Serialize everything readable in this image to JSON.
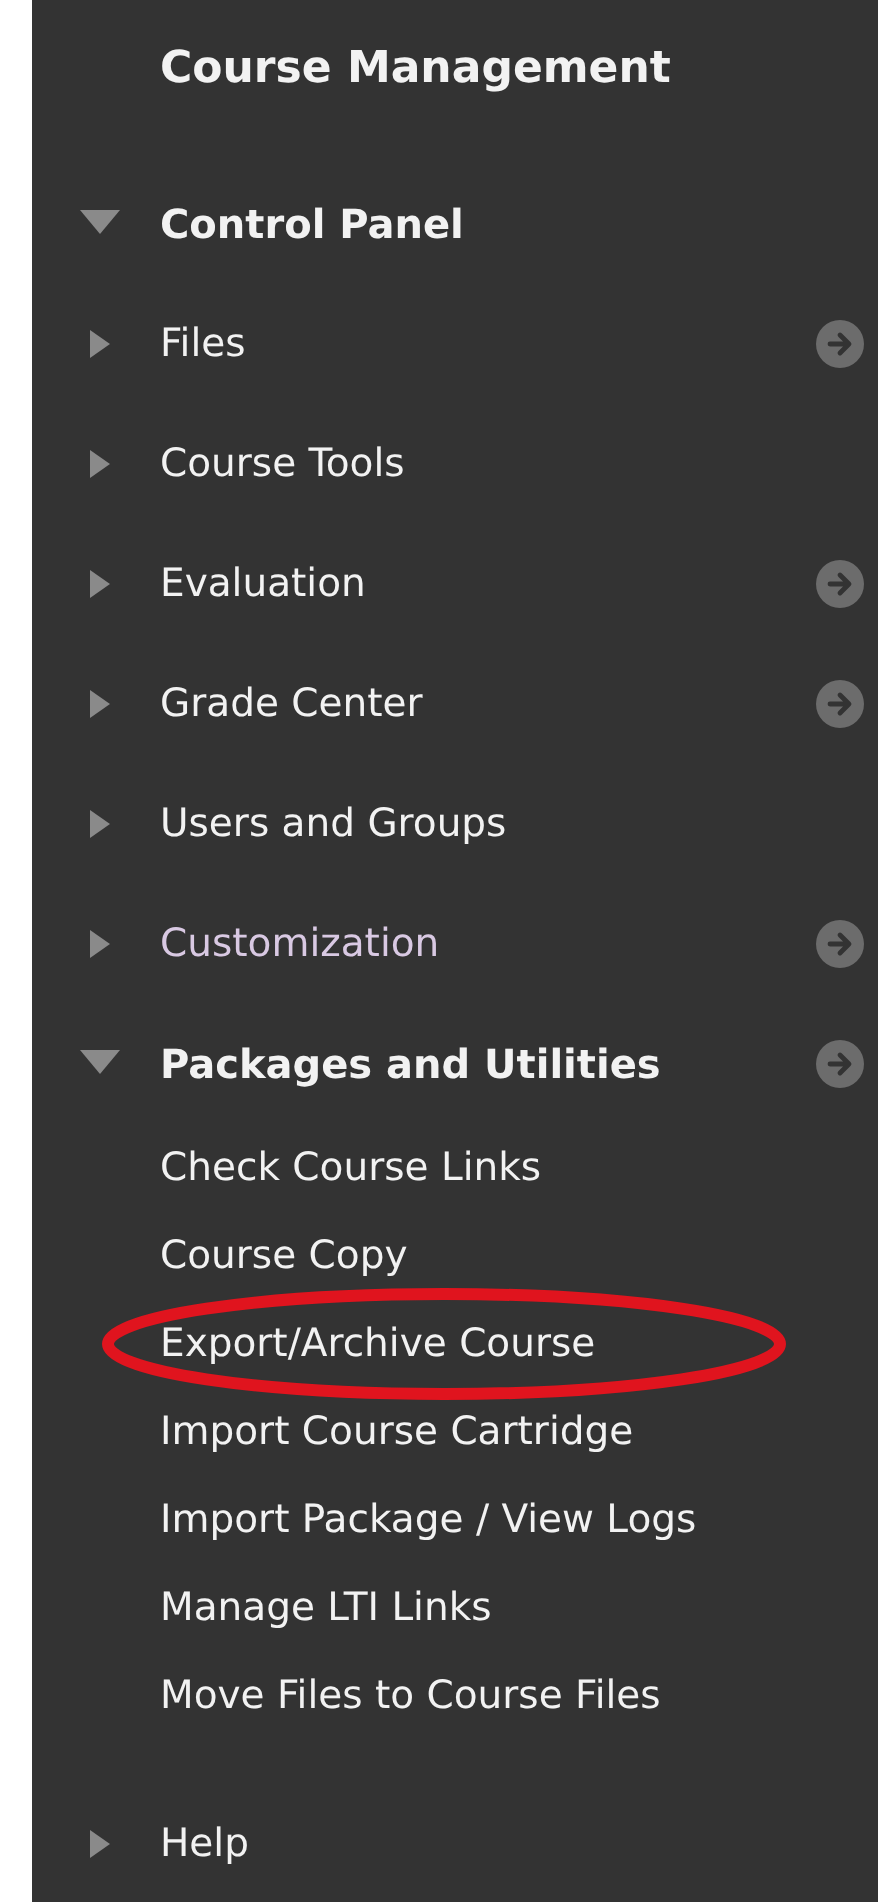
{
  "title": "Course Management",
  "control_panel": {
    "label": "Control Panel",
    "expanded": true,
    "items": [
      {
        "label": "Files",
        "expanded": false,
        "menu_button": true,
        "visited": false
      },
      {
        "label": "Course Tools",
        "expanded": false,
        "menu_button": false,
        "visited": false
      },
      {
        "label": "Evaluation",
        "expanded": false,
        "menu_button": true,
        "visited": false
      },
      {
        "label": "Grade Center",
        "expanded": false,
        "menu_button": true,
        "visited": false
      },
      {
        "label": "Users and Groups",
        "expanded": false,
        "menu_button": false,
        "visited": false
      },
      {
        "label": "Customization",
        "expanded": false,
        "menu_button": true,
        "visited": true
      },
      {
        "label": "Packages and Utilities",
        "expanded": true,
        "menu_button": true,
        "visited": false,
        "children": [
          {
            "label": "Check Course Links",
            "highlighted": false
          },
          {
            "label": "Course Copy",
            "highlighted": false
          },
          {
            "label": "Export/Archive Course",
            "highlighted": true
          },
          {
            "label": "Import Course Cartridge",
            "highlighted": false
          },
          {
            "label": "Import Package / View Logs",
            "highlighted": false
          },
          {
            "label": "Manage LTI Links",
            "highlighted": false
          },
          {
            "label": "Move Files to Course Files",
            "highlighted": false
          }
        ]
      },
      {
        "label": "Help",
        "expanded": false,
        "menu_button": false,
        "visited": false
      }
    ]
  }
}
